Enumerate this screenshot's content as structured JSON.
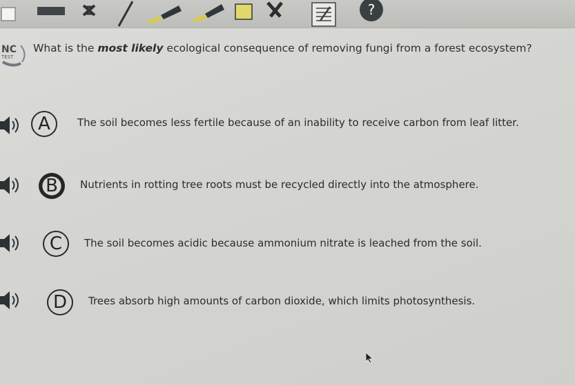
{
  "toolbar": {
    "tools": [
      {
        "name": "checkbox-icon"
      },
      {
        "name": "highlight-bar-icon"
      },
      {
        "name": "eliminate-icon"
      },
      {
        "name": "pencil-icon"
      },
      {
        "name": "highlighter-icon"
      },
      {
        "name": "marker-icon"
      },
      {
        "name": "square-icon"
      },
      {
        "name": "eraser-icon"
      },
      {
        "name": "notepad-icon"
      },
      {
        "name": "help-icon"
      }
    ],
    "help_label": "?"
  },
  "badge": {
    "line1": "NC",
    "line2": "TEST"
  },
  "question": {
    "prefix": "What is the ",
    "emphasis": "most likely",
    "suffix": " ecological consequence of removing fungi from a forest ecosystem?"
  },
  "options": [
    {
      "letter": "A",
      "text": "The soil becomes less fertile because of an inability to receive carbon from leaf litter."
    },
    {
      "letter": "B",
      "text": "Nutrients in rotting tree roots must be recycled directly into the atmosphere."
    },
    {
      "letter": "C",
      "text": "The soil becomes acidic because ammonium nitrate is leached from the soil."
    },
    {
      "letter": "D",
      "text": "Trees absorb high amounts of carbon dioxide, which limits photosynthesis."
    }
  ]
}
